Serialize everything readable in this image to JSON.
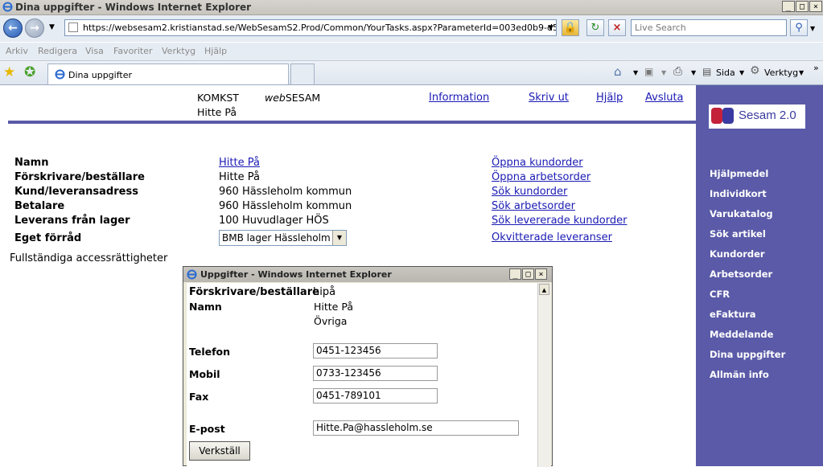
{
  "window": {
    "title": "Dina uppgifter - Windows Internet Explorer",
    "controls": [
      "_",
      "□",
      "×"
    ]
  },
  "address_bar": {
    "url": "https://websesam2.kristianstad.se/WebSesamS2.Prod/Common/YourTasks.aspx?ParameterId=003ed0b9-d544-4fd4-82",
    "search_placeholder": "Live Search"
  },
  "menu": [
    "Arkiv",
    "Redigera",
    "Visa",
    "Favoriter",
    "Verktyg",
    "Hjälp"
  ],
  "tab": {
    "label": "Dina uppgifter"
  },
  "commandbar": {
    "page_label": "Sida",
    "tools_label": "Verktyg"
  },
  "header": {
    "org": "KOMKST",
    "app_prefix": "web",
    "app_name": "SESAM",
    "user": "Hitte På",
    "links": [
      "Information",
      "Skriv ut",
      "Hjälp",
      "Avsluta"
    ]
  },
  "info": {
    "rows": [
      {
        "label": "Namn",
        "value": "Hitte På",
        "is_link": true
      },
      {
        "label": "Förskrivare/beställare",
        "value": "Hitte På"
      },
      {
        "label": "Kund/leveransadress",
        "value": "960 Hässleholm kommun"
      },
      {
        "label": "Betalare",
        "value": "960 Hässleholm kommun"
      },
      {
        "label": "Leverans från lager",
        "value": "100 Huvudlager HÖS"
      },
      {
        "label": "Eget förråd",
        "value": "BMB lager Hässleholm"
      }
    ],
    "actions": [
      "Öppna kundorder",
      "Öppna arbetsorder",
      "Sök kundorder",
      "Sök arbetsorder",
      "Sök levererade kundorder",
      "Okvitterade leveranser"
    ],
    "access": "Fullständiga accessrättigheter"
  },
  "sidebar": {
    "logo_text": "Sesam 2.0",
    "items": [
      "Hjälpmedel",
      "Individkort",
      "Varukatalog",
      "Sök artikel",
      "Kundorder",
      "Arbetsorder",
      "CFR",
      "eFaktura",
      "Meddelande",
      "Dina uppgifter",
      "Allmän info"
    ]
  },
  "popup": {
    "title": "Uppgifter - Windows Internet Explorer",
    "prescriber_label": "Förskrivare/beställare",
    "prescriber_value": "hipå",
    "name_label": "Namn",
    "name_value": "Hitte På",
    "name_value2": "Övriga",
    "phone_label": "Telefon",
    "phone_value": "0451-123456",
    "mobile_label": "Mobil",
    "mobile_value": "0733-123456",
    "fax_label": "Fax",
    "fax_value": "0451-789101",
    "email_label": "E-post",
    "email_value": "Hitte.Pa@hassleholm.se",
    "apply_label": "Verkställ"
  },
  "colors": {
    "sidebar_bg": "#5a5aa8",
    "header_rule": "#5a5aa8",
    "link": "#1b1bb4",
    "logo_red": "#c4213a",
    "logo_blue": "#3a3aa0"
  }
}
